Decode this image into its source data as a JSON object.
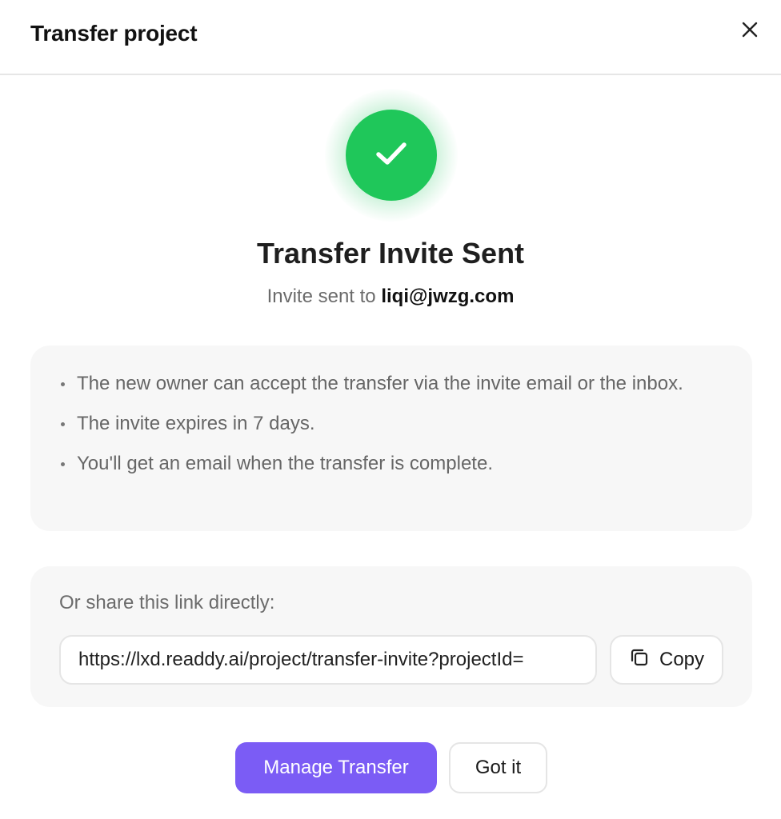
{
  "dialog": {
    "title": "Transfer project",
    "close_icon": "close-icon"
  },
  "status": {
    "icon": "checkmark-icon",
    "color": "#1fc75a",
    "title": "Transfer Invite Sent",
    "subtitle_prefix": "Invite sent to",
    "email": "liqi@jwzg.com"
  },
  "info": {
    "items": [
      "The new owner can accept the transfer via the invite email or the inbox.",
      "The invite expires in 7 days.",
      "You'll get an email when the transfer is complete."
    ]
  },
  "share": {
    "label": "Or share this link directly:",
    "link": "https://lxd.readdy.ai/project/transfer-invite?projectId=",
    "copy_label": "Copy",
    "copy_icon": "copy-icon"
  },
  "actions": {
    "primary_label": "Manage Transfer",
    "secondary_label": "Got it",
    "primary_color": "#7b5cf5"
  }
}
